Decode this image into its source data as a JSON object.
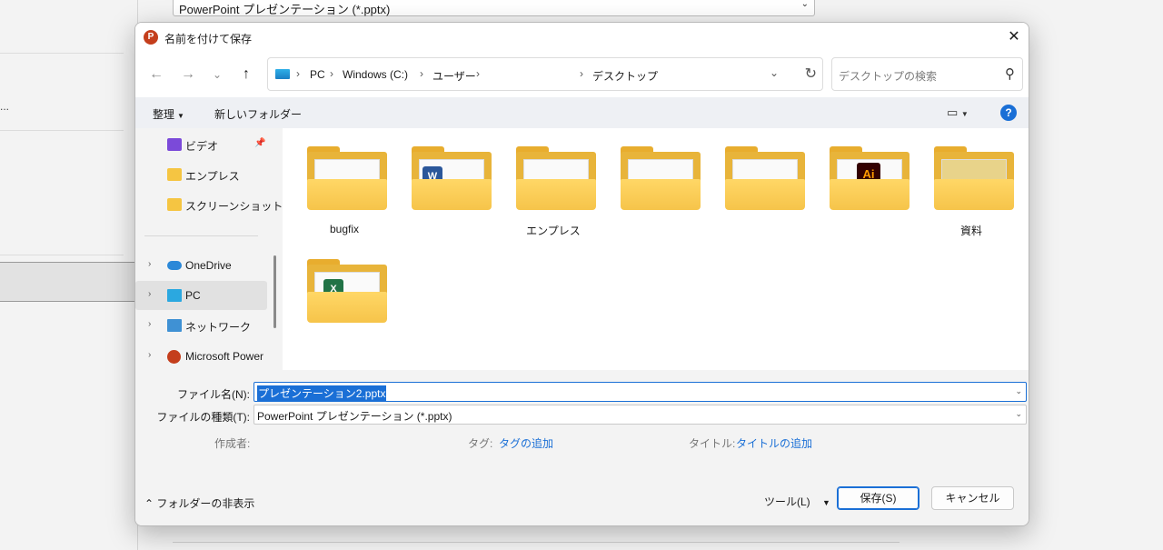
{
  "background": {
    "filetype_combo": "PowerPoint プレゼンテーション (*.pptx)",
    "ellipsis": "..."
  },
  "dialog": {
    "title": "名前を付けて保存",
    "app_icon": "P",
    "close_icon": "close-icon"
  },
  "nav": {
    "back": "←",
    "forward": "→",
    "recent": "⌄",
    "up": "↑",
    "breadcrumb": [
      "PC",
      "Windows (C:)",
      "ユーザー",
      "",
      "デスクトップ"
    ],
    "search_placeholder": "デスクトップの検索"
  },
  "cmdbar": {
    "organize": "整理",
    "new_folder": "新しいフォルダー",
    "help": "?"
  },
  "sidebar": {
    "items": [
      {
        "label": "ビデオ",
        "icon": "video-icon",
        "pinned": true
      },
      {
        "label": "エンプレス",
        "icon": "folder-icon"
      },
      {
        "label": "スクリーンショット",
        "icon": "folder-icon"
      },
      {
        "label": "OneDrive",
        "icon": "onedrive-icon"
      },
      {
        "label": "PC",
        "icon": "pc-icon",
        "selected": true
      },
      {
        "label": "ネットワーク",
        "icon": "network-icon"
      },
      {
        "label": "Microsoft Power",
        "icon": "powerpoint-icon"
      }
    ]
  },
  "files": [
    {
      "name": "bugfix",
      "badge": ""
    },
    {
      "name": "",
      "badge": "W"
    },
    {
      "name": "エンプレス",
      "badge": ""
    },
    {
      "name": "",
      "badge": ""
    },
    {
      "name": "",
      "badge": ""
    },
    {
      "name": "",
      "badge": "Ai"
    },
    {
      "name": "資料",
      "badge": ""
    },
    {
      "name": "",
      "badge": "X"
    }
  ],
  "form": {
    "filename_label": "ファイル名(N):",
    "filename_value": "プレゼンテーション2.pptx",
    "filetype_label": "ファイルの種類(T):",
    "filetype_value": "PowerPoint プレゼンテーション (*.pptx)",
    "author_label": "作成者:",
    "tags_label": "タグ:",
    "tags_value": "タグの追加",
    "title_label": "タイトル:",
    "title_value": "タイトルの追加"
  },
  "footer": {
    "hide_folders": "フォルダーの非表示",
    "tools": "ツール(L)",
    "save": "保存(S)",
    "cancel": "キャンセル"
  },
  "colors": {
    "accent": "#1a6fd6",
    "folder": "#f6c44a",
    "word": "#2b579a",
    "illustrator": "#330000",
    "excel": "#217346",
    "powerpoint": "#c43e1c"
  }
}
